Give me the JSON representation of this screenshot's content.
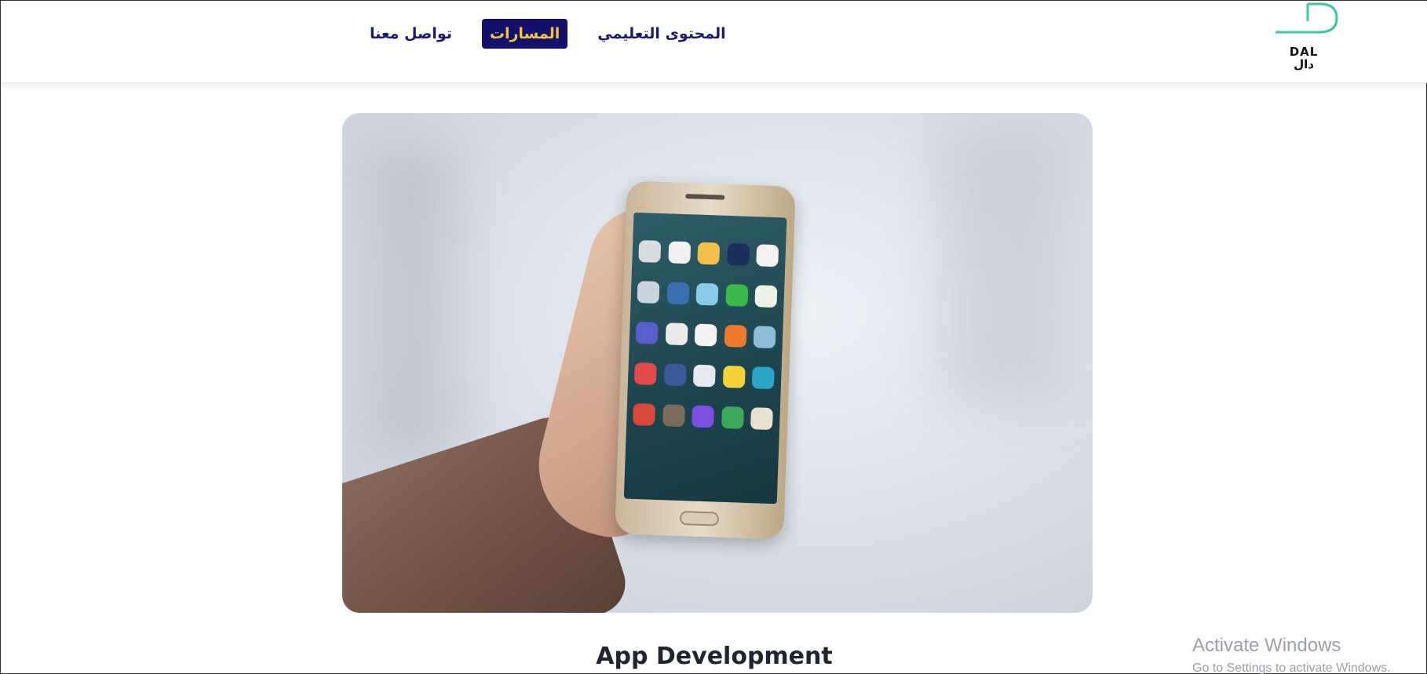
{
  "brand": {
    "name_en": "DAL",
    "name_ar": "دال",
    "accent_color": "#3cc8a0"
  },
  "nav": {
    "items": [
      {
        "label": "تواصل معنا",
        "active": false
      },
      {
        "label": "المسارات",
        "active": true
      },
      {
        "label": "المحتوى التعليمي",
        "active": false
      }
    ]
  },
  "colors": {
    "nav_text": "#1a1a6e",
    "active_bg": "#14116b",
    "active_text": "#f5c542"
  },
  "hero": {
    "image_icon": "smartphone-in-hand-photo"
  },
  "section": {
    "title": "App Development"
  },
  "watermark": {
    "line1": "Activate Windows",
    "line2": "Go to Settings to activate Windows."
  }
}
